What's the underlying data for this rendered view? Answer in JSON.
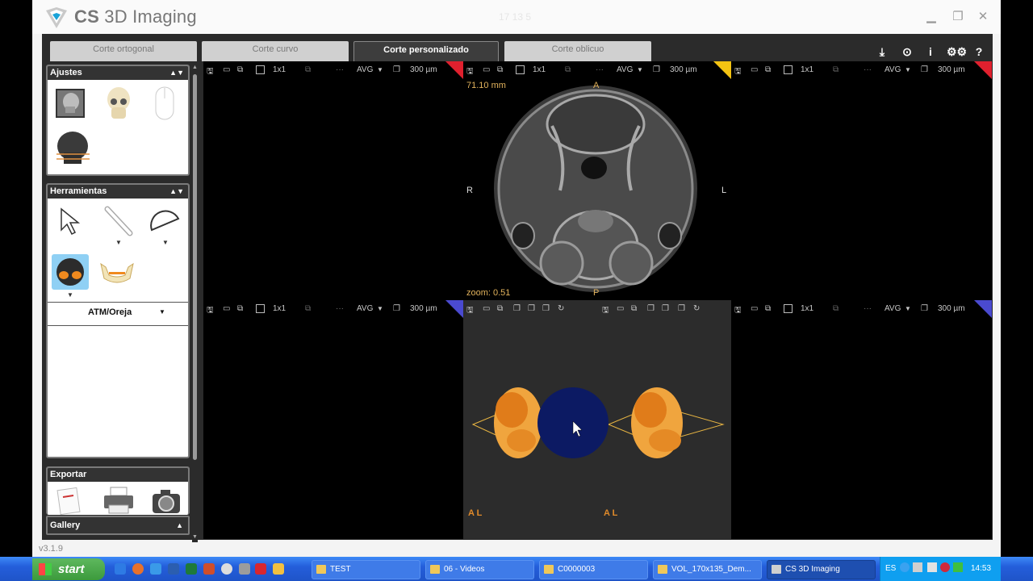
{
  "window": {
    "brand": "CS",
    "product": " 3D Imaging",
    "clock": "17 13 5",
    "version": "v3.1.9"
  },
  "tabs": [
    {
      "label": "Corte ortogonal",
      "active": false
    },
    {
      "label": "Corte curvo",
      "active": false
    },
    {
      "label": "Corte personalizado",
      "active": true
    },
    {
      "label": "Corte oblicuo",
      "active": false
    }
  ],
  "top_icons": [
    "download-icon",
    "target-icon",
    "info-icon",
    "settings-icon",
    "help-icon"
  ],
  "panels": {
    "settings": {
      "title": "Ajustes"
    },
    "tools": {
      "title": "Herramientas",
      "dropdown_value": "ATM/Oreja"
    },
    "export": {
      "title": "Exportar"
    },
    "gallery": {
      "title": "Gallery"
    }
  },
  "viewports": {
    "toolbar": {
      "layout": "1x1",
      "mode": "AVG",
      "thickness": "300 µm"
    },
    "axial": {
      "measure": "71.10 mm",
      "zoom": "zoom: 0.51",
      "anterior": "A",
      "posterior": "P",
      "right": "R",
      "left": "L"
    },
    "volume_marker": "A L"
  },
  "corner_colors": {
    "red": "#e0202e",
    "yellow": "#f4c312",
    "blue": "#4a4ad0"
  },
  "taskbar": {
    "start": "start",
    "buttons": [
      "TEST",
      "06 - Videos",
      "C0000003",
      "VOL_170x135_Dem...",
      "CS 3D Imaging"
    ],
    "active_index": 4,
    "lang": "ES",
    "time": "14:53"
  }
}
